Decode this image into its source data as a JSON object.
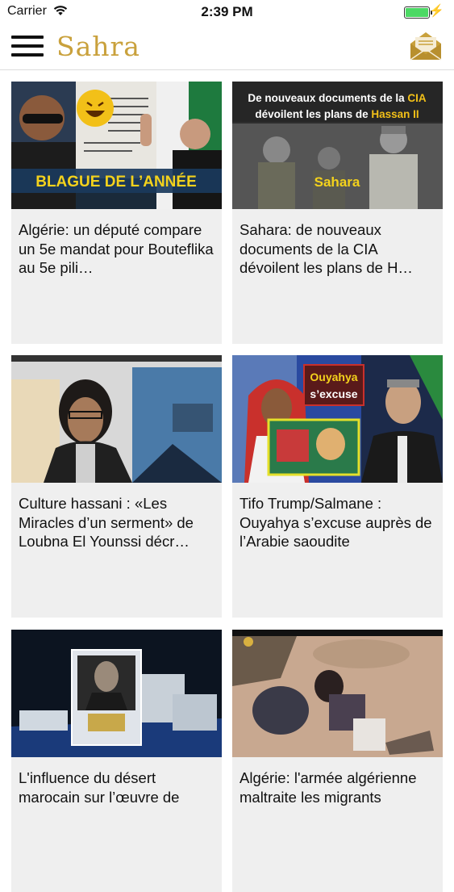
{
  "status_bar": {
    "carrier": "Carrier",
    "time": "2:39 PM",
    "battery_color": "#4cd964"
  },
  "navbar": {
    "logo_text": "Sahra",
    "logo_color": "#c9a13c",
    "menu_icon": "hamburger-icon",
    "mail_icon": "envelope-icon"
  },
  "articles": [
    {
      "title": "Algérie: un député compare un 5e mandat pour Bouteflika au 5e pili…",
      "image_caption": "BLAGUE DE L’ANNÉE"
    },
    {
      "title": "Sahara: de nouveaux documents de la CIA dévoilent les plans de H…",
      "image_headline_1": "De nouveaux documents de la ",
      "image_headline_cia": "CIA",
      "image_headline_2": "dévoilent les plans de ",
      "image_headline_hassan": "Hassan II",
      "image_caption": "Sahara"
    },
    {
      "title": "Culture hassani : «Les Miracles d’un serment» de Loubna El Younssi décr…"
    },
    {
      "title": "Tifo Trump/Salmane : Ouyahya s’excuse auprès de l’Arabie saoudite",
      "image_caption_1": "Ouyahya",
      "image_caption_2": "s’excuse"
    },
    {
      "title": "L'influence du désert marocain sur l’œuvre de"
    },
    {
      "title": "Algérie: l'armée algérienne maltraite les migrants"
    }
  ]
}
